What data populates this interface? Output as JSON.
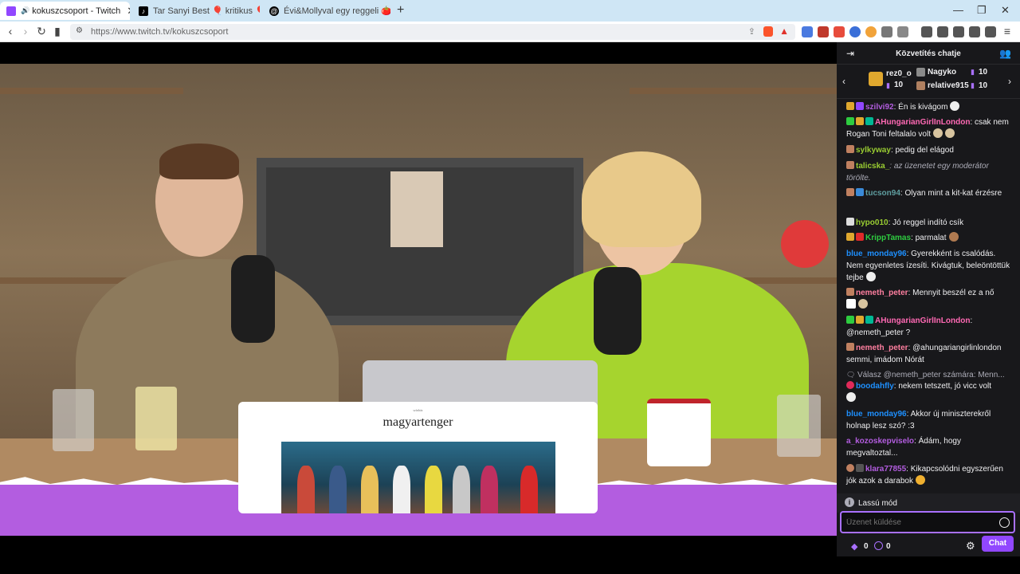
{
  "browser": {
    "tabs": [
      {
        "title": "kokuszcsoport - Twitch",
        "active": true,
        "icon": "twitch-icon",
        "color": "#9147ff"
      },
      {
        "title": "Tar Sanyi Best 🎈 kritikus 🎈 (@szop",
        "active": false,
        "icon": "tiktok-icon",
        "color": "#000000"
      },
      {
        "title": "Évi&Mollyval egy reggeli 🍅😍 (@m",
        "active": false,
        "icon": "threads-icon",
        "color": "#000000"
      }
    ],
    "new_tab": "+",
    "url": "https://www.twitch.tv/kokuszcsoport"
  },
  "video": {
    "article_kicker": "színház",
    "article_title": "magyartenger"
  },
  "chat": {
    "title": "Közvetítés chatje",
    "gifters": [
      {
        "name": "rez0_o",
        "count": "10"
      },
      {
        "name": "Nagyko",
        "count": "10"
      },
      {
        "name": "relative915",
        "count": "10"
      }
    ],
    "messages": [
      {
        "user": "szilvi92",
        "color": "#b35de0",
        "text": ": Én is kivágom"
      },
      {
        "user": "AHungarianGirlInLondon",
        "color": "#ff69b4",
        "text": ": csak nem Rogan Toni feltalalo volt"
      },
      {
        "user": "sylkyway",
        "color": "#9acd32",
        "text": ": pedig del elágod"
      },
      {
        "user": "talicska_",
        "color": "#9acd32",
        "text": ": az üzenetet egy moderátor törölte.",
        "deleted": true
      },
      {
        "user": "tucson94",
        "color": "#5f9ea0",
        "text": ": Olyan mint a kit-kat érzésre"
      },
      {
        "user": "hypo010",
        "color": "#9acd32",
        "text": ": Jó reggel indító csík"
      },
      {
        "user": "KrippTamas",
        "color": "#1e90ff",
        "text": ": parmalat"
      },
      {
        "user": "blue_monday96",
        "color": "#1e90ff",
        "text": ": Gyerekként is csalódás. Nem egyenletes ízesíti. Kivágtuk, beleöntöttük tejbe"
      },
      {
        "user": "nemeth_peter",
        "color": "#ff7fa0",
        "text": ": Mennyit beszél ez a nő"
      },
      {
        "user": "AHungarianGirlInLondon",
        "color": "#ff69b4",
        "text": ": @nemeth_peter ?"
      },
      {
        "user": "nemeth_peter",
        "color": "#ff7fa0",
        "text": ": @ahungariangirlinlondon semmi, imádom Nórát"
      },
      {
        "reply": "Válasz @nemeth_peter számára: Menn..."
      },
      {
        "user": "boodahfly",
        "color": "#1e90ff",
        "text": ": nekem tetszett, jó vicc volt"
      },
      {
        "user": "blue_monday96",
        "color": "#1e90ff",
        "text": ": Akkor új miniszterekről holnap lesz szó? :3"
      },
      {
        "user": "a_kozoskepviselo",
        "color": "#b35de0",
        "text": ": Ádám, hogy megvaltoztal..."
      },
      {
        "user": "klara77855",
        "color": "#b35de0",
        "text": ": Kikapcsolódni egyszerűen jók azok a darabok"
      }
    ],
    "slow_mode": "Lassú mód",
    "input_placeholder": "Üzenet küldése",
    "points": "0",
    "bits": "0",
    "send_label": "Chat"
  }
}
